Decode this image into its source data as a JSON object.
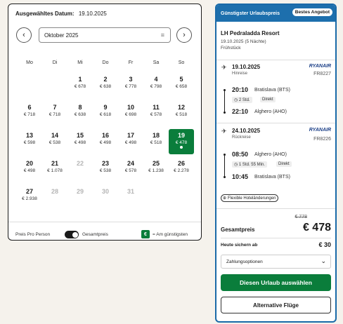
{
  "calendar": {
    "header_label": "Ausgewähltes Datum:",
    "header_date": "19.10.2025",
    "month": "Oktober 2025",
    "weekdays": [
      "Mo",
      "Di",
      "Mi",
      "Do",
      "Fr",
      "Sa",
      "So"
    ],
    "days": [
      {
        "n": "1",
        "p": "€ 678"
      },
      {
        "n": "2",
        "p": "€ 638"
      },
      {
        "n": "3",
        "p": "€ 778"
      },
      {
        "n": "4",
        "p": "€ 798"
      },
      {
        "n": "5",
        "p": "€ 658"
      },
      {
        "n": "6",
        "p": "€ 718"
      },
      {
        "n": "7",
        "p": "€ 718"
      },
      {
        "n": "8",
        "p": "€ 638"
      },
      {
        "n": "9",
        "p": "€ 618"
      },
      {
        "n": "10",
        "p": "€ 698"
      },
      {
        "n": "11",
        "p": "€ 578"
      },
      {
        "n": "12",
        "p": "€ 518"
      },
      {
        "n": "13",
        "p": "€ 598"
      },
      {
        "n": "14",
        "p": "€ 538"
      },
      {
        "n": "15",
        "p": "€ 498"
      },
      {
        "n": "16",
        "p": "€ 498"
      },
      {
        "n": "17",
        "p": "€ 498"
      },
      {
        "n": "18",
        "p": "€ 518"
      },
      {
        "n": "19",
        "p": "€ 478"
      },
      {
        "n": "20",
        "p": "€ 498"
      },
      {
        "n": "21",
        "p": "€ 1.078"
      },
      {
        "n": "22",
        "p": ""
      },
      {
        "n": "23",
        "p": "€ 538"
      },
      {
        "n": "24",
        "p": "€ 578"
      },
      {
        "n": "25",
        "p": "€ 1.238"
      },
      {
        "n": "26",
        "p": "€ 2.278"
      },
      {
        "n": "27",
        "p": "€ 2.938"
      },
      {
        "n": "28",
        "p": ""
      },
      {
        "n": "29",
        "p": ""
      },
      {
        "n": "30",
        "p": ""
      },
      {
        "n": "31",
        "p": ""
      }
    ],
    "selected_day": "19",
    "footer_left": "Preis Pro Person",
    "footer_mid": "Gesamtpreis",
    "footer_chip": "€",
    "footer_right": "= Am günstigsten"
  },
  "offer": {
    "bar_title": "Günstigster Urlaubspreis",
    "badge": "Bestes Angebot",
    "hotel_name": "LH Pedraladda Resort",
    "hotel_dates": "19.10.2025 (5 Nächte)",
    "hotel_board": "Frühstück",
    "outbound": {
      "date": "19.10.2025",
      "type": "Hinreise",
      "airline": "RYANAIR",
      "flight_no": "FR8227",
      "dep_time": "20:10",
      "dep_place": "Bratislava (BTS)",
      "duration": "2 Std.",
      "direct": "Direkt",
      "arr_time": "22:10",
      "arr_place": "Alghero (AHO)"
    },
    "inbound": {
      "date": "24.10.2025",
      "type": "Rückreise",
      "airline": "RYANAIR",
      "flight_no": "FR8226",
      "dep_time": "08:50",
      "dep_place": "Alghero (AHO)",
      "duration": "1 Std. 55 Min.",
      "direct": "Direkt",
      "arr_time": "10:45",
      "arr_place": "Bratislava (BTS)"
    },
    "flex_label": "Flexible Hoteländerungen",
    "old_price": "€ 778",
    "total_label": "Gesamtpreis",
    "total": "€ 478",
    "today_label": "Heute sichern ab",
    "today_value": "€ 30",
    "payment_label": "Zahlungsoptionen",
    "cta_label": "Diesen Urlaub auswählen",
    "alt_label": "Alternative Flüge"
  }
}
